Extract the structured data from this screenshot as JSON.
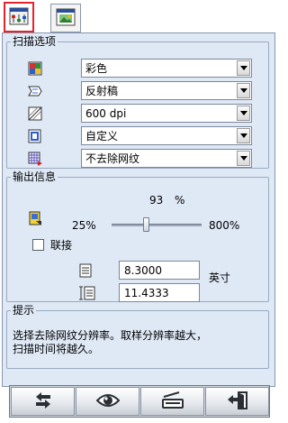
{
  "tabs": [
    {
      "icon": "settings-sliders-icon",
      "active": true
    },
    {
      "icon": "image-preview-icon",
      "active": false
    }
  ],
  "scan_options": {
    "title": "扫描选项",
    "rows": [
      {
        "icon": "color-mode-icon",
        "value": "彩色"
      },
      {
        "icon": "document-type-icon",
        "value": "反射稿"
      },
      {
        "icon": "resolution-icon",
        "value": "600 dpi"
      },
      {
        "icon": "document-size-icon",
        "value": "自定义"
      },
      {
        "icon": "descreen-icon",
        "value": "不去除网纹"
      }
    ]
  },
  "output_info": {
    "title": "输出信息",
    "scale_percent": "93",
    "percent_sign": "%",
    "slider_min": "25%",
    "slider_max": "800%",
    "slider_value": 93,
    "link_label": "联接",
    "link_checked": false,
    "width_value": "8.3000",
    "height_value": "11.4333",
    "unit": "英寸"
  },
  "hint": {
    "title": "提示",
    "text": "选择去除网纹分辨率。取样分辨率越大，\n扫描时间将越久。"
  },
  "toolbar": {
    "buttons": [
      {
        "icon": "swap-arrows-icon"
      },
      {
        "icon": "preview-eye-icon"
      },
      {
        "icon": "scan-icon"
      },
      {
        "icon": "exit-door-icon"
      }
    ]
  },
  "colors": {
    "panel_bg": "#dfe9f6",
    "active_tab_border": "#e5232a"
  }
}
